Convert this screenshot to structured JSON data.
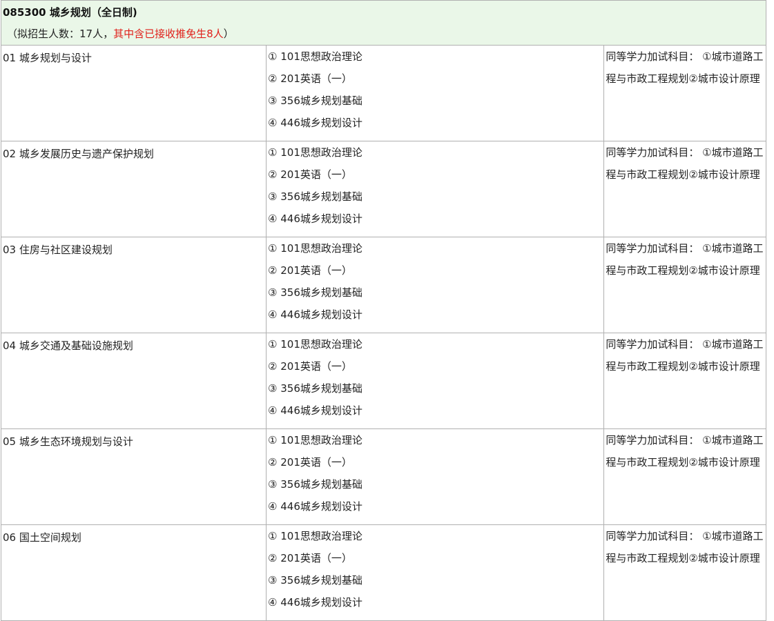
{
  "header": {
    "title": "085300 城乡规划（全日制)",
    "enroll_prefix": "（拟招生人数：17人，",
    "enroll_highlight": "其中含已接收推免生8人",
    "enroll_suffix": "）"
  },
  "rows": [
    {
      "direction": "01 城乡规划与设计",
      "subjects": [
        "① 101思想政治理论",
        "② 201英语（一）",
        "③ 356城乡规划基础",
        "④ 446城乡规划设计"
      ],
      "note": "同等学力加试科目： ①城市道路工程与市政工程规划②城市设计原理"
    },
    {
      "direction": "02 城乡发展历史与遗产保护规划",
      "subjects": [
        "① 101思想政治理论",
        "② 201英语（一）",
        "③ 356城乡规划基础",
        "④ 446城乡规划设计"
      ],
      "note": "同等学力加试科目： ①城市道路工程与市政工程规划②城市设计原理"
    },
    {
      "direction": "03 住房与社区建设规划",
      "subjects": [
        "① 101思想政治理论",
        "② 201英语（一）",
        "③ 356城乡规划基础",
        "④ 446城乡规划设计"
      ],
      "note": "同等学力加试科目： ①城市道路工程与市政工程规划②城市设计原理"
    },
    {
      "direction": "04 城乡交通及基础设施规划",
      "subjects": [
        "① 101思想政治理论",
        "② 201英语（一）",
        "③ 356城乡规划基础",
        "④ 446城乡规划设计"
      ],
      "note": "同等学力加试科目： ①城市道路工程与市政工程规划②城市设计原理"
    },
    {
      "direction": "05 城乡生态环境规划与设计",
      "subjects": [
        "① 101思想政治理论",
        "② 201英语（一）",
        "③ 356城乡规划基础",
        "④ 446城乡规划设计"
      ],
      "note": "同等学力加试科目： ①城市道路工程与市政工程规划②城市设计原理"
    },
    {
      "direction": "06 国土空间规划",
      "subjects": [
        "① 101思想政治理论",
        "② 201英语（一）",
        "③ 356城乡规划基础",
        "④ 446城乡规划设计"
      ],
      "note": "同等学力加试科目： ①城市道路工程与市政工程规划②城市设计原理"
    }
  ]
}
